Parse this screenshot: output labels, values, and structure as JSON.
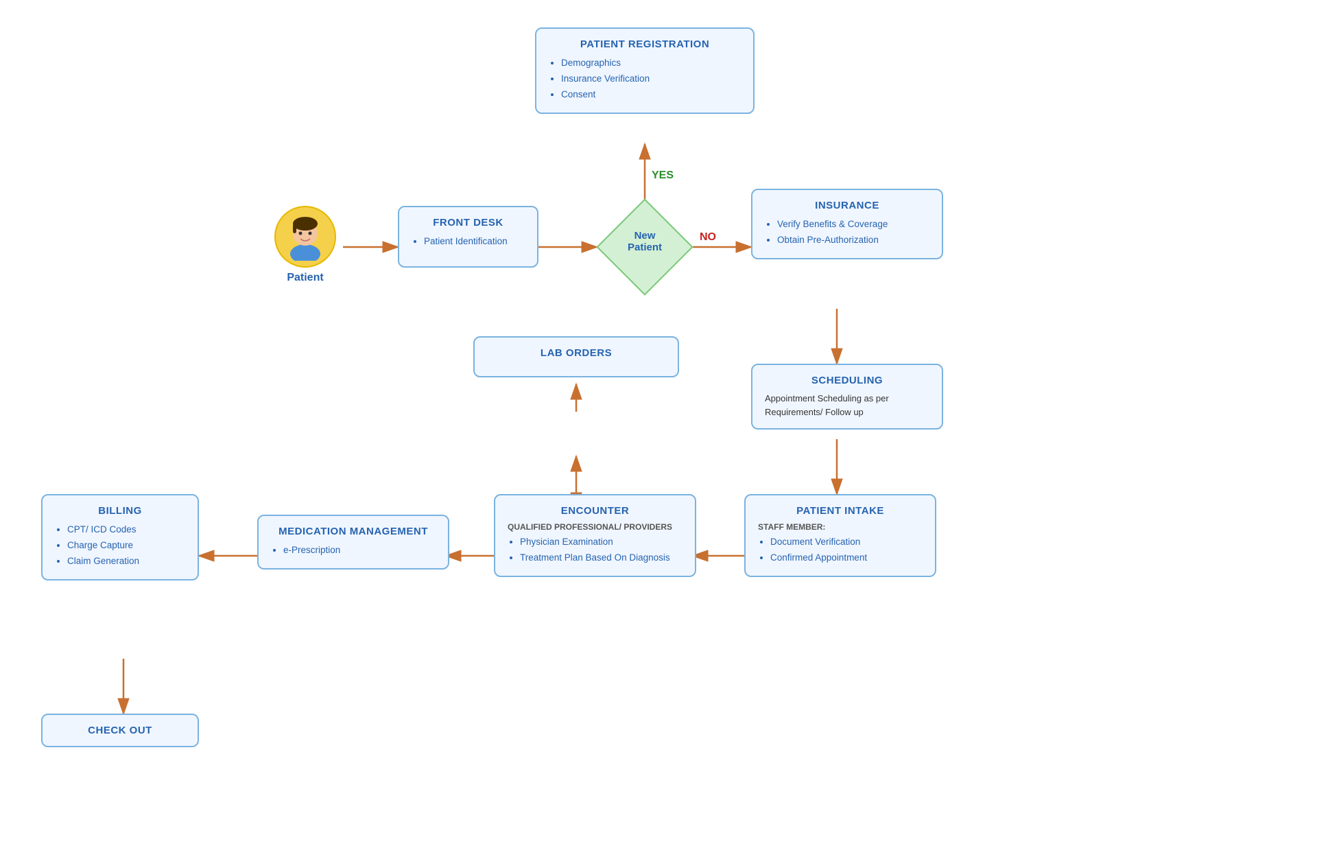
{
  "patient": {
    "label": "Patient"
  },
  "front_desk": {
    "title": "FRONT DESK",
    "items": [
      "Patient Identification"
    ]
  },
  "diamond": {
    "label": "New\nPatient"
  },
  "patient_registration": {
    "title": "PATIENT REGISTRATION",
    "items": [
      "Demographics",
      "Insurance Verification",
      "Consent"
    ]
  },
  "insurance": {
    "title": "INSURANCE",
    "items": [
      "Verify Benefits & Coverage",
      "Obtain Pre-Authorization"
    ]
  },
  "scheduling": {
    "title": "SCHEDULING",
    "text": "Appointment Scheduling as per Requirements/ Follow up"
  },
  "patient_intake": {
    "title": "PATIENT INTAKE",
    "subtitle": "STAFF MEMBER:",
    "items": [
      "Document Verification",
      "Confirmed Appointment"
    ]
  },
  "encounter": {
    "title": "ENCOUNTER",
    "subtitle": "QUALIFIED PROFESSIONAL/ PROVIDERS",
    "items": [
      "Physician Examination",
      "Treatment Plan Based On Diagnosis"
    ]
  },
  "lab_orders": {
    "title": "LAB ORDERS"
  },
  "medication_management": {
    "title": "MEDICATION MANAGEMENT",
    "items": [
      "e-Prescription"
    ]
  },
  "billing": {
    "title": "BILLING",
    "items": [
      "CPT/ ICD Codes",
      "Charge Capture",
      "Claim Generation"
    ]
  },
  "check_out": {
    "title": "CHECK OUT"
  },
  "yes_label": "YES",
  "no_label": "NO"
}
